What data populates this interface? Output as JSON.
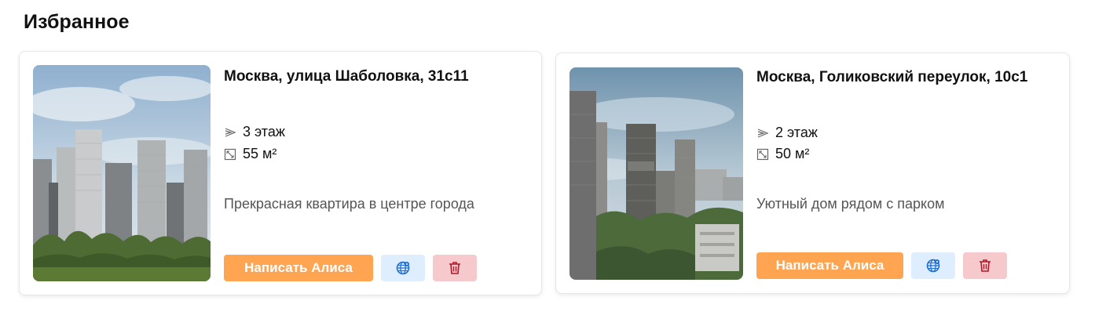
{
  "page": {
    "title": "Избранное"
  },
  "colors": {
    "write_button": "#ffa451",
    "map_button_bg": "#dfeeff",
    "map_icon": "#1f6fd6",
    "delete_button_bg": "#f6c9cd",
    "delete_icon": "#b01828"
  },
  "favorites": [
    {
      "address": "Москва, улица Шаболовка, 31с11",
      "floor": "3 этаж",
      "area": "55 м²",
      "description": "Прекрасная квартира в центре города",
      "write_label": "Написать Алиса",
      "photo": "residential-complex-photo",
      "floor_icon": "stairs-icon",
      "area_icon": "area-icon",
      "map_icon": "globe-location-icon",
      "delete_icon": "trash-icon"
    },
    {
      "address": "Москва, Голиковский переулок, 10с1",
      "floor": "2 этаж",
      "area": "50 м²",
      "description": "Уютный дом рядом с парком",
      "write_label": "Написать Алиса",
      "photo": "residential-towers-photo",
      "floor_icon": "stairs-icon",
      "area_icon": "area-icon",
      "map_icon": "globe-location-icon",
      "delete_icon": "trash-icon"
    }
  ]
}
